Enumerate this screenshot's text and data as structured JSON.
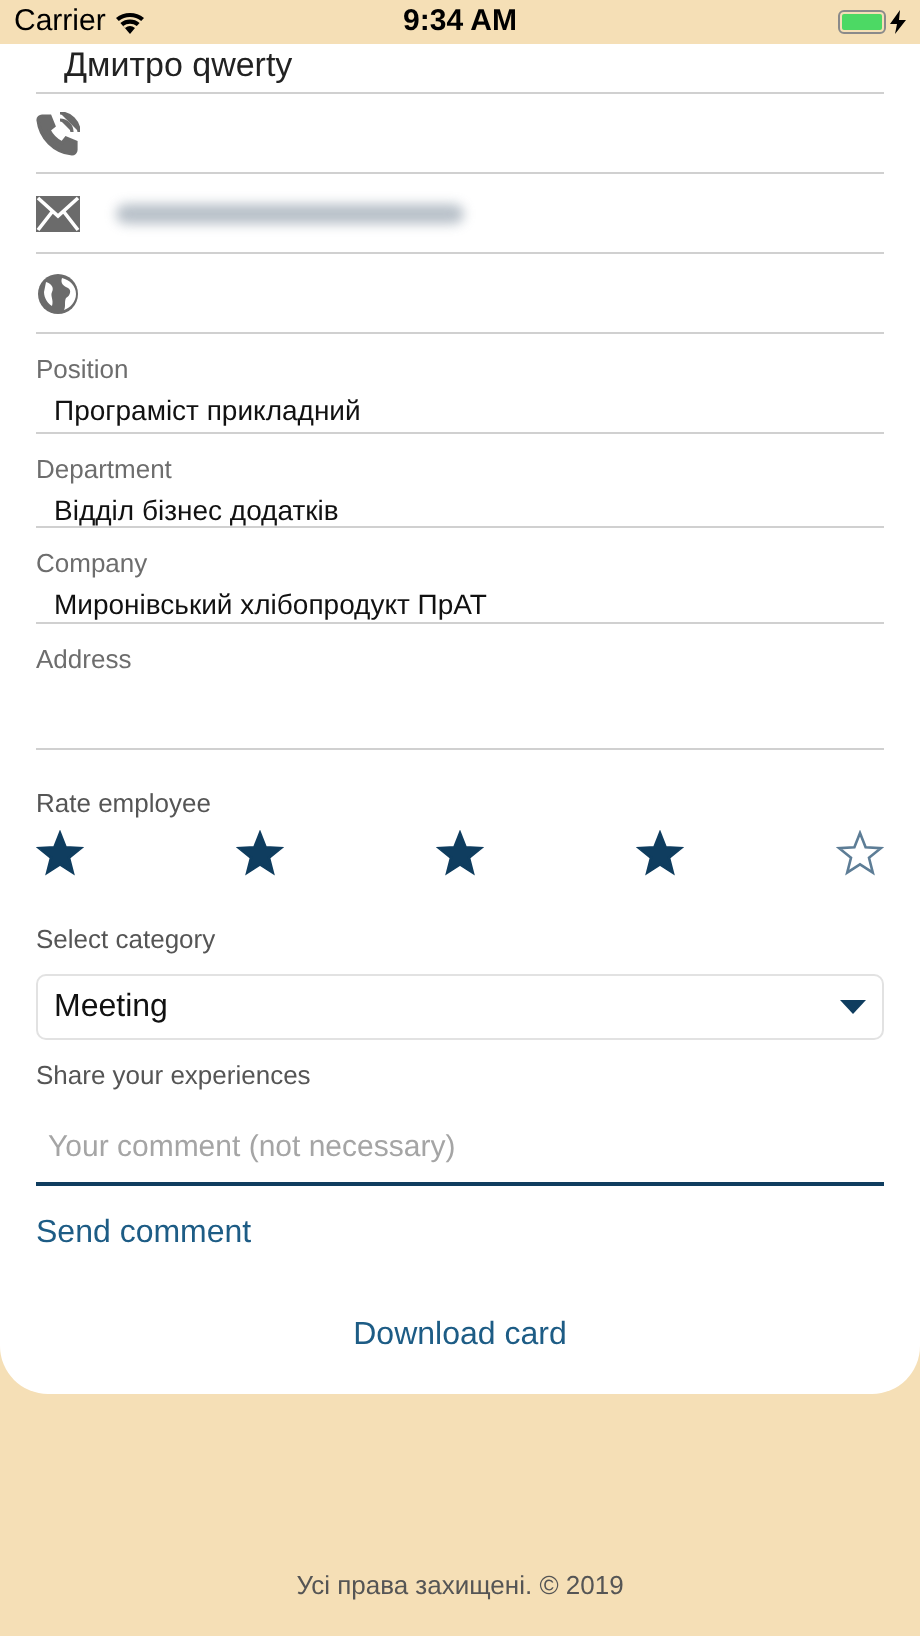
{
  "status_bar": {
    "carrier": "Carrier",
    "time": "9:34 AM",
    "battery": {
      "level": 1,
      "charging": true
    }
  },
  "contact": {
    "name": "Дмитро qwerty",
    "rows": [
      {
        "kind": "phone"
      },
      {
        "kind": "email",
        "blurred": true
      },
      {
        "kind": "web"
      }
    ]
  },
  "fields": [
    {
      "label": "Position",
      "value": "Програміст прикладний"
    },
    {
      "label": "Department",
      "value": "Відділ бізнес додатків"
    },
    {
      "label": "Company",
      "value": "Миронівський хлібопродукт ПрАТ"
    },
    {
      "label": "Address"
    }
  ],
  "rating": {
    "label": "Rate employee",
    "stars": 4
  },
  "category": {
    "label": "Select category",
    "value": "Meeting"
  },
  "comment": {
    "label": "Share your experiences",
    "placeholder": "Your comment (not necessary)"
  },
  "send_button": "Send comment",
  "download_button": "Download card",
  "footer": "Усі права захищені. © 2019"
}
